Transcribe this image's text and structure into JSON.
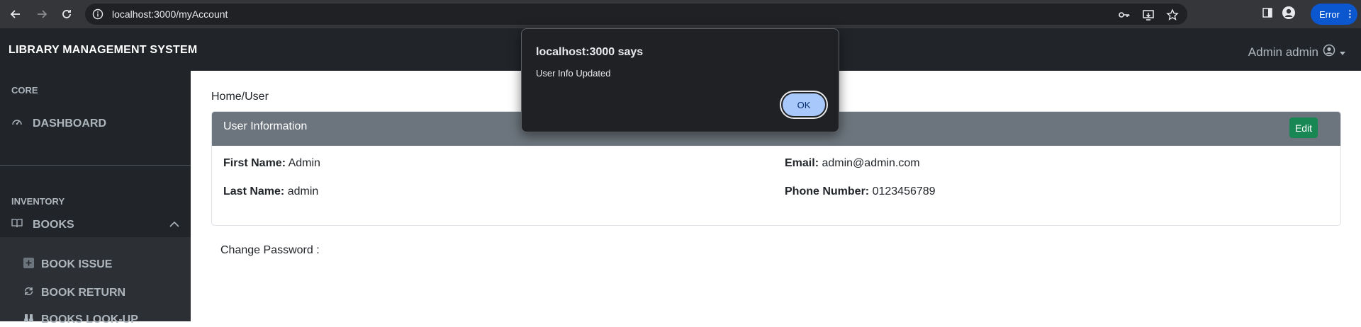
{
  "browser": {
    "url": "localhost:3000/myAccount",
    "profile_status": "Error"
  },
  "navbar": {
    "brand": "LIBRARY MANAGEMENT SYSTEM",
    "user": "Admin admin"
  },
  "sidebar": {
    "core_heading": "CORE",
    "dashboard": "DASHBOARD",
    "inventory_heading": "INVENTORY",
    "books": "BOOKS",
    "book_issue": "BOOK ISSUE",
    "book_return": "BOOK RETURN",
    "books_lookup": "BOOKS LOOK-UP"
  },
  "main": {
    "breadcrumb": "Home/User",
    "card_title": "User Information",
    "edit_label": "Edit",
    "first_name_label": "First Name:",
    "first_name": "Admin",
    "last_name_label": "Last Name:",
    "last_name": "admin",
    "email_label": "Email:",
    "email": "admin@admin.com",
    "phone_label": "Phone Number:",
    "phone": "0123456789",
    "change_password": "Change Password :"
  },
  "dialog": {
    "title": "localhost:3000 says",
    "message": "User Info Updated",
    "ok_label": "OK"
  },
  "colors": {
    "navbar_bg": "#212529",
    "card_header_bg": "#6c757d",
    "edit_button": "#198754",
    "dialog_bg": "#202124",
    "ok_button": "#a8c7fa"
  }
}
